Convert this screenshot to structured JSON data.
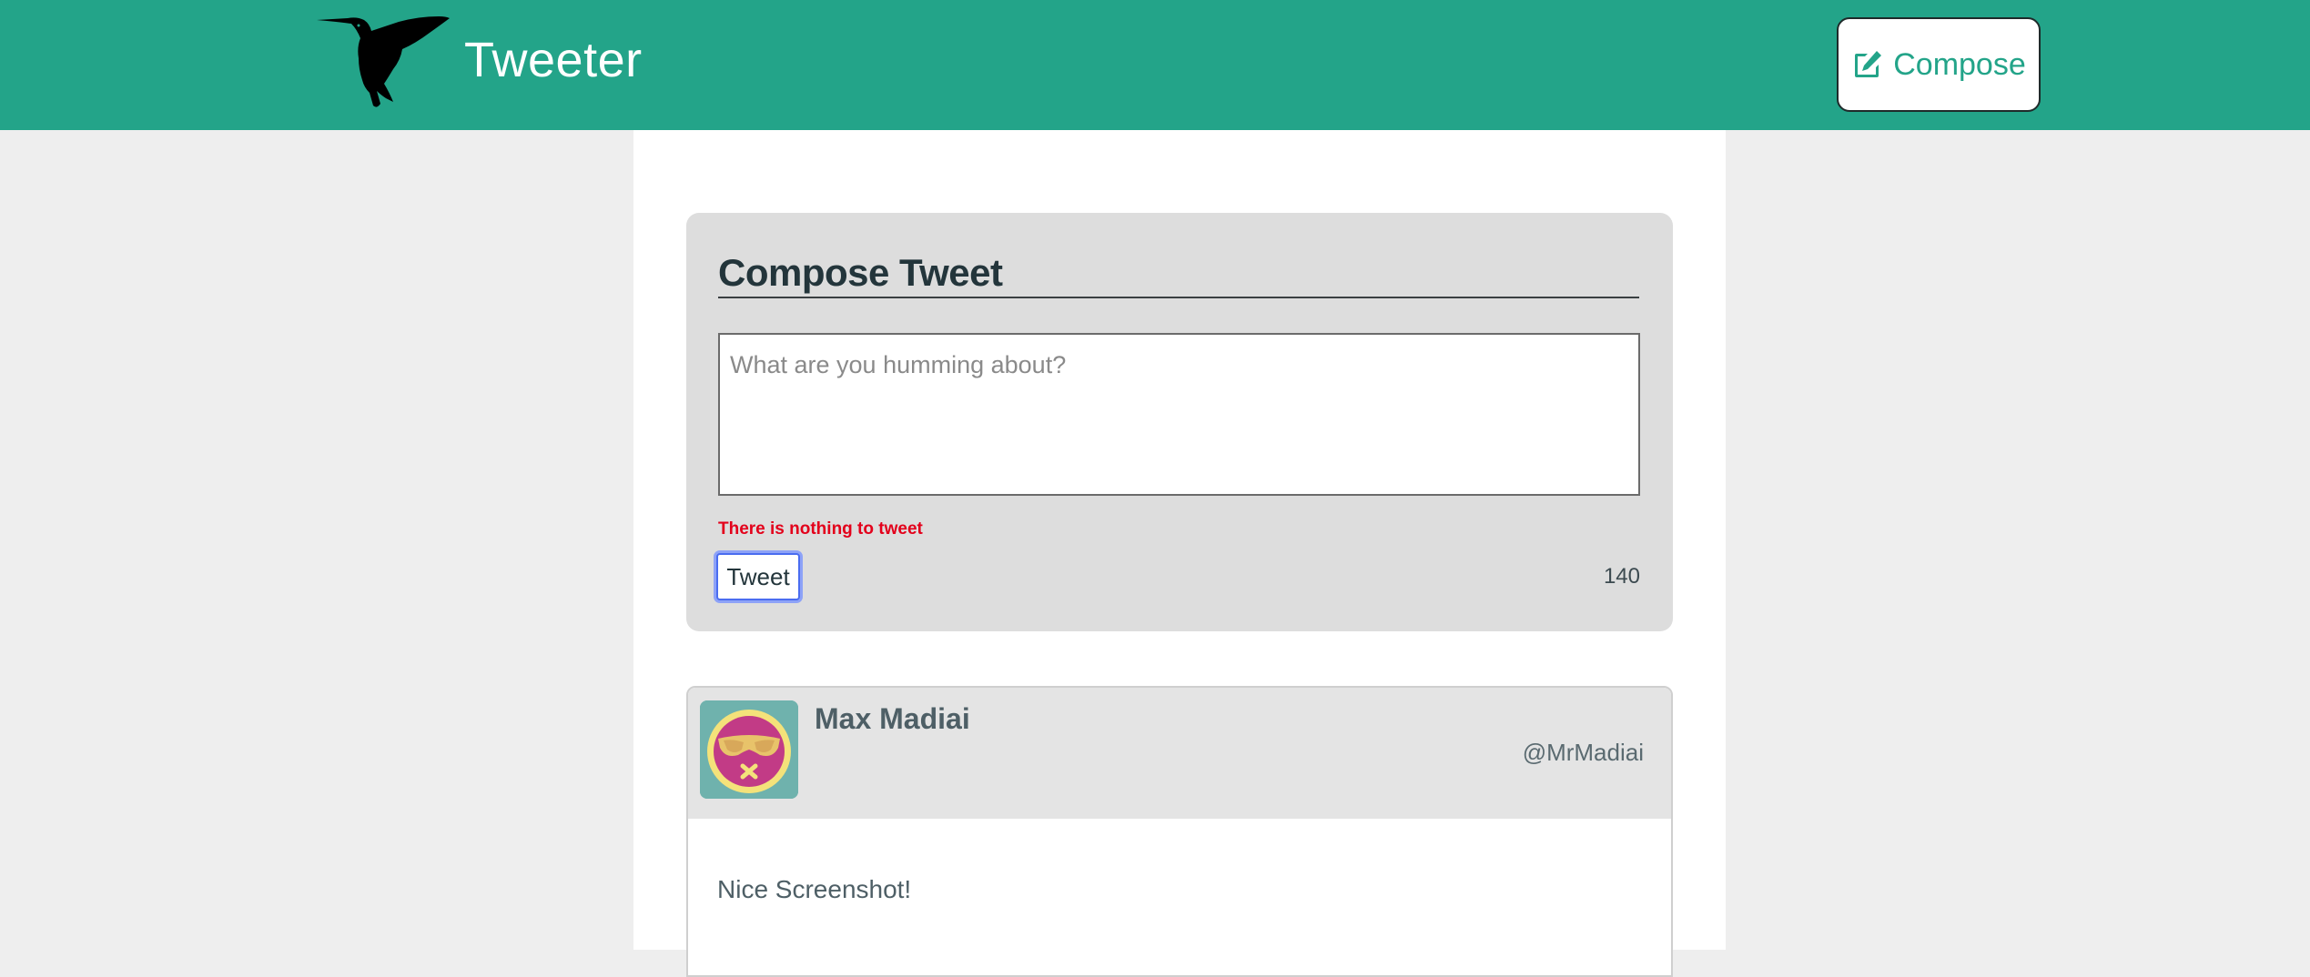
{
  "nav": {
    "title": "Tweeter",
    "logo_icon": "hummingbird-icon",
    "compose_label": "Compose",
    "compose_icon": "edit-icon",
    "background_color": "#23a489"
  },
  "compose": {
    "heading": "Compose Tweet",
    "textarea": {
      "placeholder": "What are you humming about?",
      "value": ""
    },
    "error": "There is nothing to tweet",
    "tweet_button_label": "Tweet",
    "counter": "140",
    "error_color": "#e3001b"
  },
  "tweets": [
    {
      "avatar_icon": "avatar-sunglasses-icon",
      "name": "Max Madiai",
      "handle": "@MrMadiai",
      "body": "Nice Screenshot!"
    }
  ]
}
